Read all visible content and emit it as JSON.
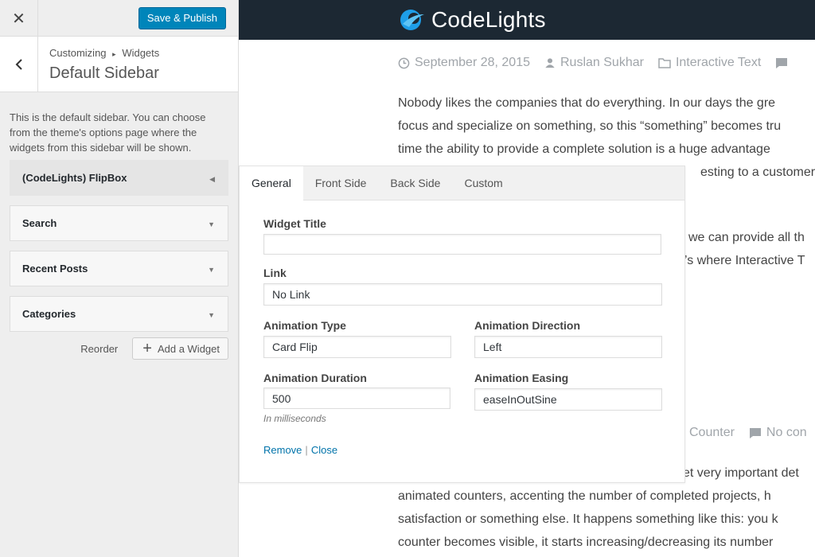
{
  "customizer": {
    "close_icon": "close-icon",
    "publish_label": "Save & Publish",
    "breadcrumb": {
      "root": "Customizing",
      "separator": "▸",
      "current": "Widgets"
    },
    "section_title": "Default Sidebar",
    "description": "This is the default sidebar. You can choose from the theme's options page where the widgets from this sidebar will be shown.",
    "widgets": [
      {
        "label": "(CodeLights) FlipBox"
      },
      {
        "label": "Search"
      },
      {
        "label": "Recent Posts"
      },
      {
        "label": "Categories"
      }
    ],
    "reorder_label": "Reorder",
    "add_widget_label": "Add a Widget"
  },
  "preview": {
    "brand": "CodeLights",
    "brand_color": "#1e9ee8",
    "post1": {
      "date": "September 28, 2015",
      "author": "Ruslan Sukhar",
      "category": "Interactive Text",
      "lines": [
        "Nobody likes the companies that do everything. In our days the gre",
        "focus and specialize on something, so this “something” becomes tru",
        "time the ability to provide a complete solution is a huge advantage",
        "esting to a customer"
      ]
    },
    "post1_more": [
      "we can provide all th",
      "’s where Interactive T"
    ],
    "post2": {
      "category": "Counter",
      "comments": "No con",
      "lines": [
        "et very important det",
        "animated counters, accenting the number of completed projects, h",
        "satisfaction or something else. It happens something like this: you k",
        "counter becomes visible, it starts increasing/decreasing its number"
      ]
    }
  },
  "form": {
    "tabs": [
      "General",
      "Front Side",
      "Back Side",
      "Custom"
    ],
    "widget_title_label": "Widget Title",
    "widget_title_value": "",
    "link_label": "Link",
    "link_value": "No Link",
    "anim_type_label": "Animation Type",
    "anim_type_value": "Card Flip",
    "anim_dir_label": "Animation Direction",
    "anim_dir_value": "Left",
    "anim_dur_label": "Animation Duration",
    "anim_dur_value": "500",
    "anim_dur_hint": "In milliseconds",
    "anim_ease_label": "Animation Easing",
    "anim_ease_value": "easeInOutSine",
    "remove_label": "Remove",
    "link_separator": "|",
    "close_label": "Close"
  }
}
